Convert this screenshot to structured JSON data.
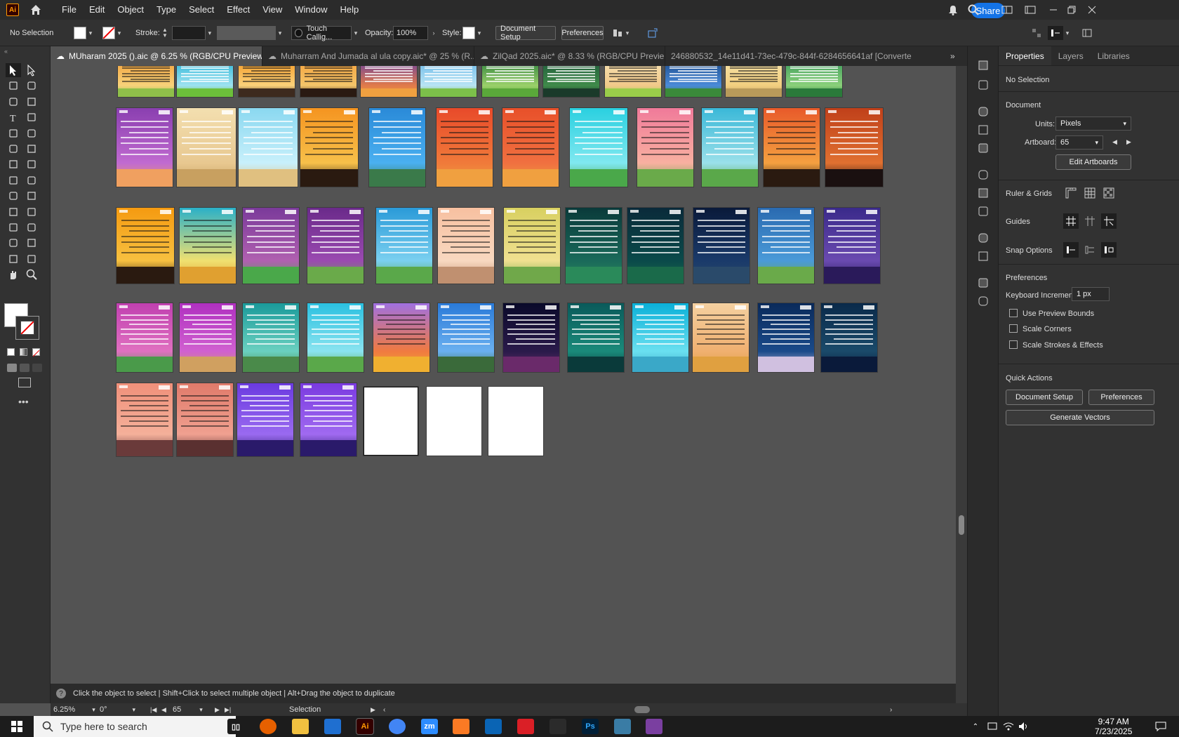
{
  "app": {
    "name": "Ai"
  },
  "menubar": {
    "items": [
      "File",
      "Edit",
      "Object",
      "Type",
      "Select",
      "Effect",
      "View",
      "Window",
      "Help"
    ],
    "share_label": "Share"
  },
  "control_bar": {
    "selection": "No Selection",
    "stroke_label": "Stroke:",
    "brush": "Touch Callig...",
    "opacity_label": "Opacity:",
    "opacity_value": "100%",
    "style_label": "Style:",
    "document_setup": "Document Setup",
    "preferences": "Preferences"
  },
  "tabs": [
    {
      "label": "MUharam 2025 ().aic @ 6.25 % (RGB/CPU Preview)",
      "active": true
    },
    {
      "label": "Muharram And Jumada al ula copy.aic* @ 25 % (R...",
      "active": false
    },
    {
      "label": "ZilQad 2025.aic* @ 8.33 % (RGB/CPU Previe...",
      "active": false
    },
    {
      "label": "246880532_14e11d41-73ec-479c-844f-6284656641af [Converte",
      "active": false
    }
  ],
  "hint_bar": {
    "text": "Click the object to select  |  Shift+Click to select multiple object  |  Alt+Drag the object to duplicate"
  },
  "status_bar": {
    "zoom": "6.25%",
    "rotation": "0°",
    "artboard": "65",
    "tool": "Selection"
  },
  "panel": {
    "tabs": [
      "Properties",
      "Layers",
      "Libraries"
    ],
    "no_selection": "No Selection",
    "document_heading": "Document",
    "units_label": "Units:",
    "units_value": "Pixels",
    "artboard_label": "Artboard:",
    "artboard_value": "65",
    "edit_artboards": "Edit Artboards",
    "rulers_grids": "Ruler & Grids",
    "guides": "Guides",
    "snap_options": "Snap Options",
    "preferences_heading": "Preferences",
    "keyboard_increment_label": "Keyboard Increment:",
    "keyboard_increment_value": "1 px",
    "checkboxes": [
      "Use Preview Bounds",
      "Scale Corners",
      "Scale Strokes & Effects"
    ],
    "quick_actions": "Quick Actions",
    "qa_document_setup": "Document Setup",
    "qa_preferences": "Preferences",
    "qa_generate_vectors": "Generate Vectors"
  },
  "taskbar": {
    "search_placeholder": "Type here to search",
    "time": "9:47 AM",
    "date": "7/23/2025"
  },
  "artboard_themes": {
    "count": 56,
    "blank_artboards": 3
  }
}
